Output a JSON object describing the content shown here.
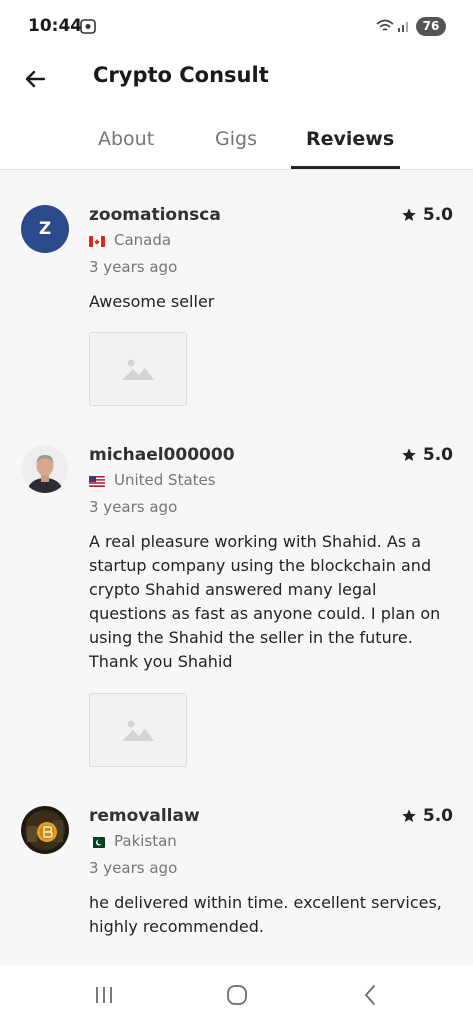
{
  "status_bar": {
    "time": "10:44",
    "battery": "76"
  },
  "header": {
    "title": "Crypto Consult"
  },
  "tabs": [
    {
      "label": "About",
      "active": false
    },
    {
      "label": "Gigs",
      "active": false
    },
    {
      "label": "Reviews",
      "active": true
    }
  ],
  "reviews": [
    {
      "username": "zoomationsca",
      "avatar_letter": "Z",
      "country": "Canada",
      "date": "3 years ago",
      "rating": "5.0",
      "text": "Awesome seller"
    },
    {
      "username": "michael000000",
      "country": "United States",
      "date": "3 years ago",
      "rating": "5.0",
      "text": "A real pleasure working with Shahid.  As a startup company using the blockchain and crypto Shahid answered many legal questions as fast as anyone could.  I plan on using the Shahid the seller in the future.  Thank you Shahid"
    },
    {
      "username": "removallaw",
      "country": "Pakistan",
      "date": "3 years ago",
      "rating": "5.0",
      "text": "he delivered within time. excellent services, highly recommended."
    }
  ],
  "colors": {
    "primary_text": "#222325",
    "secondary_text": "#74767e",
    "avatar_z": "#2b4a8c",
    "star": "#222325"
  }
}
